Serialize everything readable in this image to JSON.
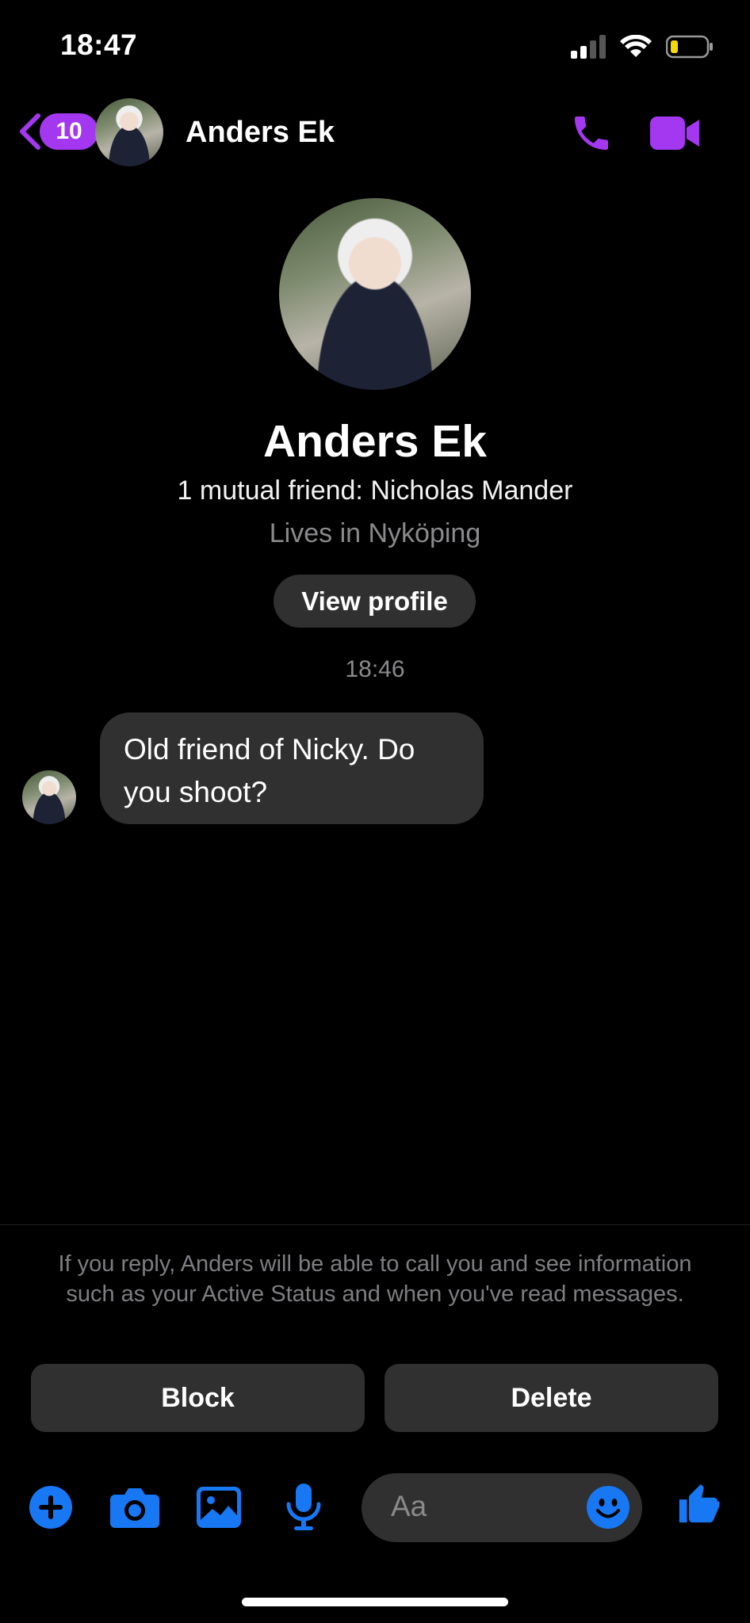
{
  "status_bar": {
    "time": "18:47",
    "icons": [
      "signal-icon",
      "wifi-icon",
      "battery-icon"
    ]
  },
  "header": {
    "back_icon": "chevron-left-icon",
    "unread_count": "10",
    "contact_name": "Anders Ek",
    "actions": [
      "phone-icon",
      "video-camera-icon"
    ],
    "accent_color": "#a437f0"
  },
  "profile": {
    "name": "Anders Ek",
    "mutual": "1 mutual friend: Nicholas Mander",
    "location": "Lives in Nyköping",
    "view_profile_label": "View profile"
  },
  "conversation": {
    "timestamp": "18:46",
    "messages": [
      {
        "from": "Anders Ek",
        "text": "Old friend of Nicky. Do you shoot?"
      }
    ]
  },
  "request_notice": {
    "text": "If you reply, Anders will be able to call you and see information such as your Active Status and when you've read messages.",
    "block_label": "Block",
    "delete_label": "Delete"
  },
  "composer": {
    "placeholder": "Aa",
    "tools": [
      "plus-icon",
      "camera-icon",
      "image-icon",
      "microphone-icon"
    ],
    "emoji_icon": "smiley-icon",
    "like_icon": "thumbs-up-icon",
    "tool_color": "#1877f2"
  }
}
